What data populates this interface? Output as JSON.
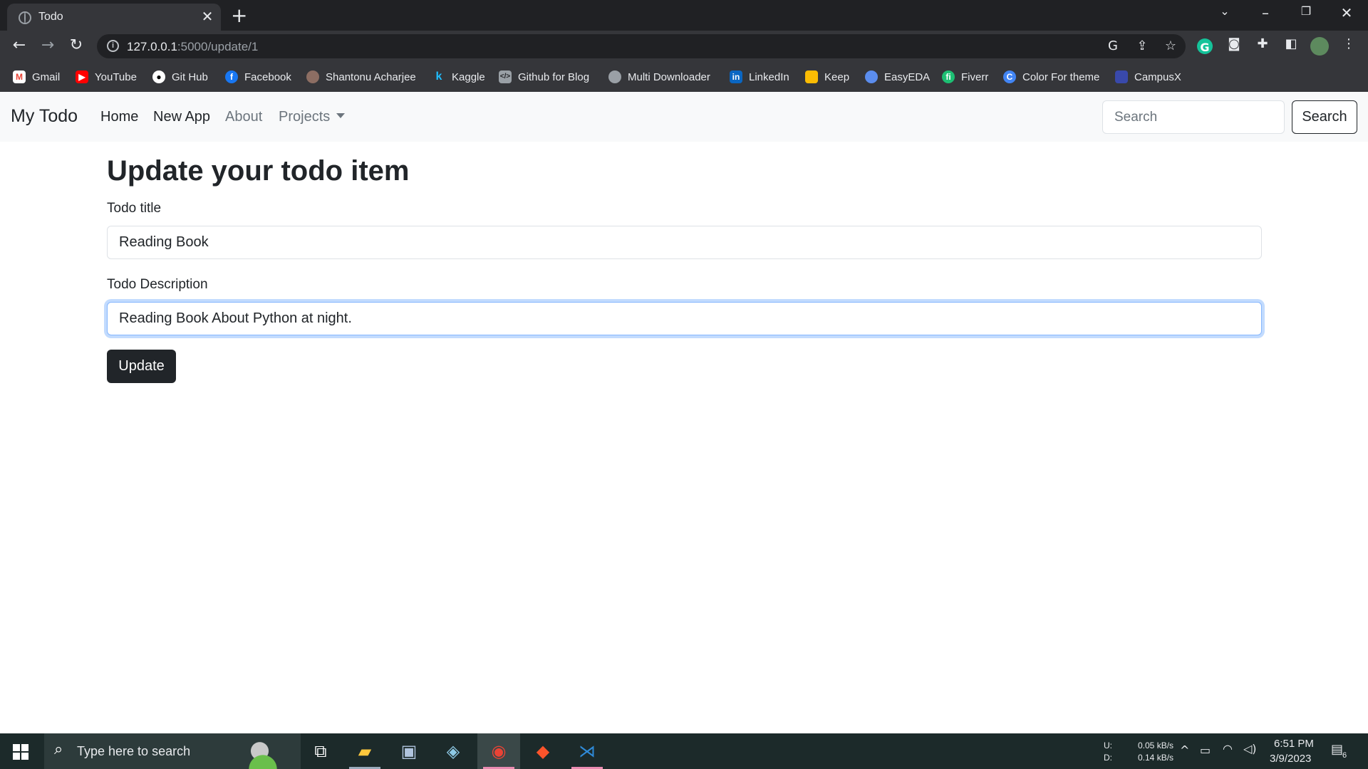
{
  "browser": {
    "tab_title": "Todo",
    "url_host": "127.0.0.1",
    "url_path": ":5000/update/1",
    "bookmarks": [
      {
        "label": "Gmail",
        "icon": "gmail-icon",
        "color": "#ea4335"
      },
      {
        "label": "YouTube",
        "icon": "youtube-icon",
        "color": "#ff0000"
      },
      {
        "label": "Git Hub",
        "icon": "github-icon",
        "color": "#ffffff"
      },
      {
        "label": "Facebook",
        "icon": "facebook-icon",
        "color": "#1877f2"
      },
      {
        "label": "Shantonu Acharjee",
        "icon": "profile-icon",
        "color": "#8d6e63"
      },
      {
        "label": "Kaggle",
        "icon": "kaggle-icon",
        "color": "#20beff"
      },
      {
        "label": "Github for Blog",
        "icon": "code-icon",
        "color": "#9aa0a6"
      },
      {
        "label": "Multi Downloader",
        "icon": "globe-icon",
        "color": "#9aa0a6"
      },
      {
        "label": "LinkedIn",
        "icon": "linkedin-icon",
        "color": "#0a66c2"
      },
      {
        "label": "Keep",
        "icon": "keep-icon",
        "color": "#fbbc04"
      },
      {
        "label": "EasyEDA",
        "icon": "easyeda-icon",
        "color": "#5b8dee"
      },
      {
        "label": "Fiverr",
        "icon": "fiverr-icon",
        "color": "#1dbf73"
      },
      {
        "label": "Color For theme",
        "icon": "color-icon",
        "color": "#4285f4"
      },
      {
        "label": "CampusX",
        "icon": "campusx-icon",
        "color": "#3949ab"
      }
    ]
  },
  "navbar": {
    "brand": "My Todo",
    "links": [
      "Home",
      "New App",
      "About",
      "Projects"
    ],
    "search_placeholder": "Search",
    "search_button": "Search"
  },
  "form": {
    "heading": "Update your todo item",
    "title_label": "Todo title",
    "title_value": "Reading Book",
    "desc_label": "Todo Description",
    "desc_value": "Reading Book About Python at night.",
    "submit_label": "Update"
  },
  "taskbar": {
    "search_placeholder": "Type here to search",
    "net_up_label": "U:",
    "net_down_label": "D:",
    "net_up": "0.05 kB/s",
    "net_down": "0.14 kB/s",
    "time": "6:51 PM",
    "date": "3/9/2023",
    "notifications": "6"
  },
  "colors": {
    "accent_focus": "#86b7fe",
    "dark_button": "#212529",
    "navbar_bg": "#f8f9fa"
  }
}
